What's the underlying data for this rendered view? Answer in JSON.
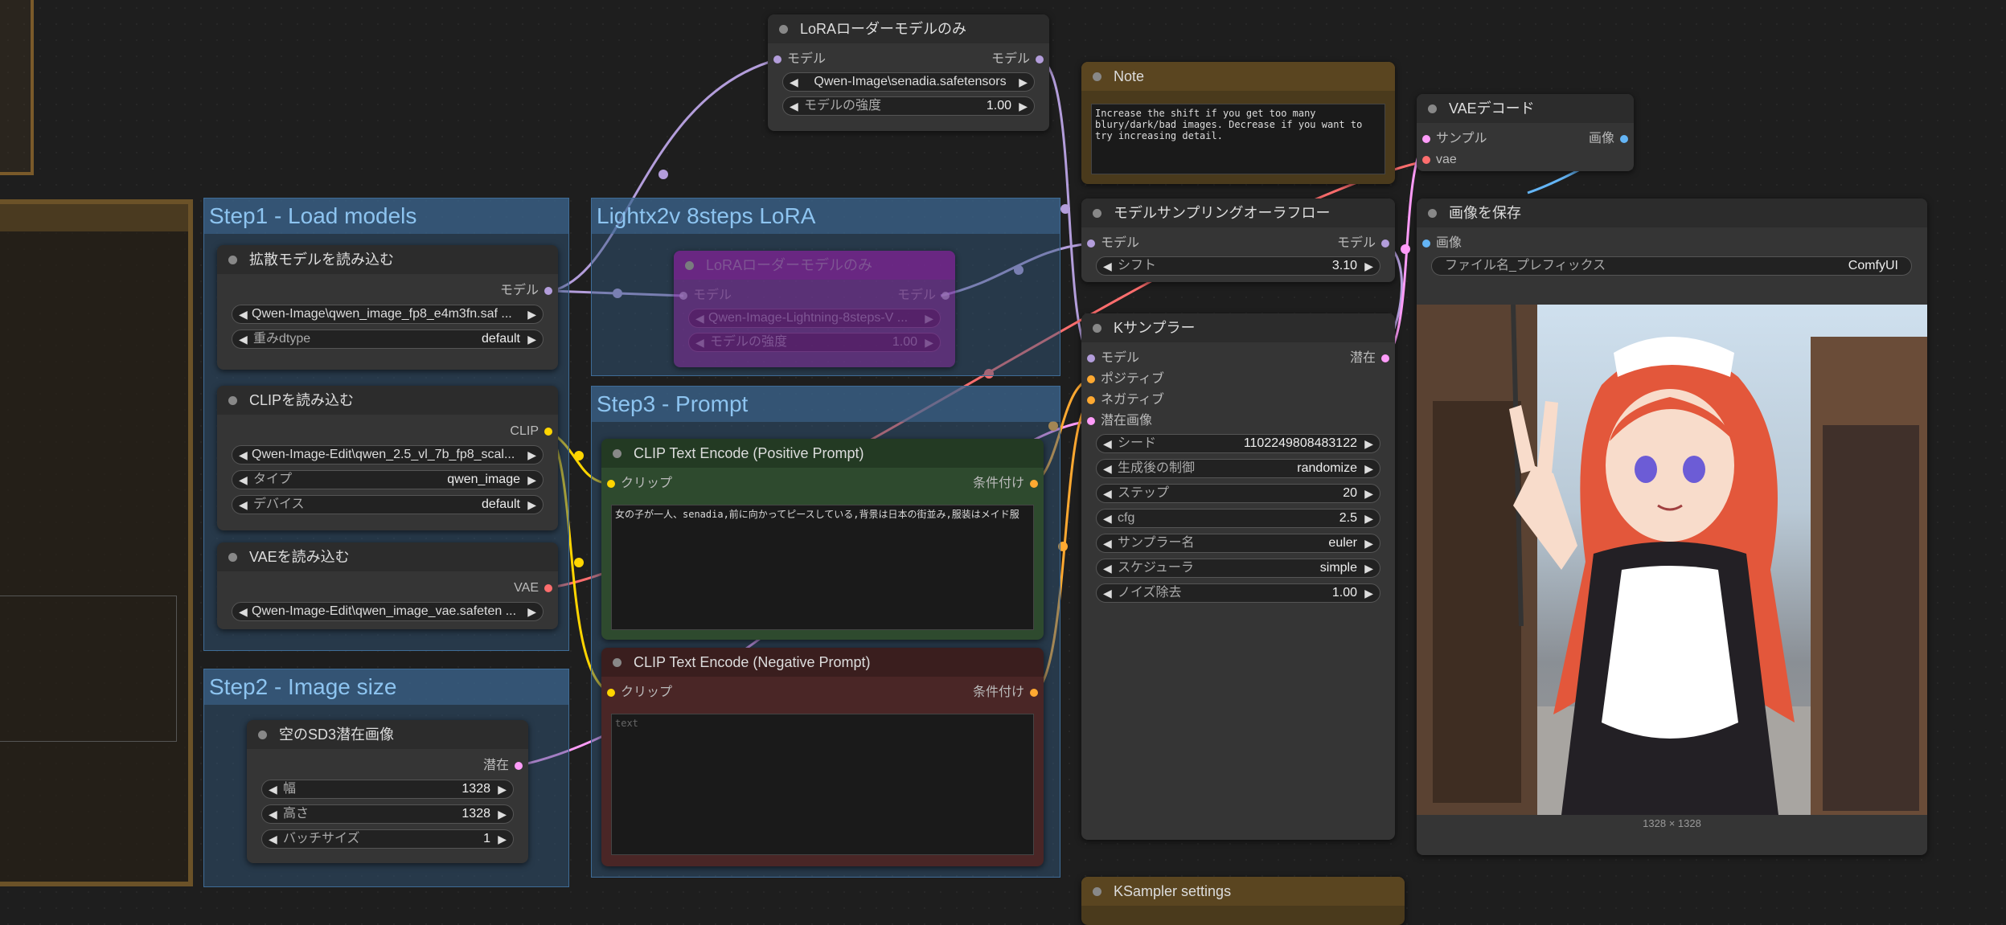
{
  "groups": {
    "step1": "Step1 - Load models",
    "step2": "Step2 - Image size",
    "step3": "Step3 - Prompt",
    "lightx2v": "Lightx2v 8steps LoRA"
  },
  "nodes": {
    "lora_top": {
      "title": "LoRAローダーモデルのみ",
      "in_model": "モデル",
      "out_model": "モデル",
      "lora_name": "Qwen-Image\\senadia.safetensors",
      "strength_label": "モデルの強度",
      "strength": "1.00"
    },
    "note": {
      "title": "Note",
      "text": "Increase the shift if you get too many blury/dark/bad images. Decrease if you want to try increasing detail."
    },
    "vae_decode": {
      "title": "VAEデコード",
      "in_samples": "サンプル",
      "in_vae": "vae",
      "out_image": "画像"
    },
    "model_sampling": {
      "title": "モデルサンプリングオーラフロー",
      "in_model": "モデル",
      "out_model": "モデル",
      "shift_label": "シフト",
      "shift": "3.10"
    },
    "ksampler": {
      "title": "Kサンプラー",
      "in_model": "モデル",
      "in_positive": "ポジティブ",
      "in_negative": "ネガティブ",
      "in_latent": "潜在画像",
      "out_latent": "潜在",
      "widgets": [
        {
          "label": "シード",
          "value": "1102249808483122"
        },
        {
          "label": "生成後の制御",
          "value": "randomize"
        },
        {
          "label": "ステップ",
          "value": "20"
        },
        {
          "label": "cfg",
          "value": "2.5"
        },
        {
          "label": "サンプラー名",
          "value": "euler"
        },
        {
          "label": "スケジューラ",
          "value": "simple"
        },
        {
          "label": "ノイズ除去",
          "value": "1.00"
        }
      ]
    },
    "save_image": {
      "title": "画像を保存",
      "in_image": "画像",
      "prefix_label": "ファイル名_プレフィックス",
      "prefix": "ComfyUI",
      "dims": "1328 × 1328"
    },
    "diffusion_loader": {
      "title": "拡散モデルを読み込む",
      "out_model": "モデル",
      "unet_name": "Qwen-Image\\qwen_image_fp8_e4m3fn.saf ...",
      "dtype_label": "重みdtype",
      "dtype": "default"
    },
    "lora_bypassed": {
      "title": "LoRAローダーモデルのみ",
      "in_model": "モデル",
      "out_model": "モデル",
      "lora_name": "Qwen-Image-Lightning-8steps-V ...",
      "strength_label": "モデルの強度",
      "strength": "1.00"
    },
    "clip_loader": {
      "title": "CLIPを読み込む",
      "out_clip": "CLIP",
      "clip_name": "Qwen-Image-Edit\\qwen_2.5_vl_7b_fp8_scal...",
      "type_label": "タイプ",
      "type": "qwen_image",
      "device_label": "デバイス",
      "device": "default"
    },
    "vae_loader": {
      "title": "VAEを読み込む",
      "out_vae": "VAE",
      "vae_name": "Qwen-Image-Edit\\qwen_image_vae.safeten ..."
    },
    "clip_pos": {
      "title": "CLIP Text Encode (Positive Prompt)",
      "in_clip": "クリップ",
      "out_cond": "条件付け",
      "text": "女の子が一人、senadia,前に向かってピースしている,背景は日本の街並み,服装はメイド服"
    },
    "clip_neg": {
      "title": "CLIP Text Encode (Negative Prompt)",
      "in_clip": "クリップ",
      "out_cond": "条件付け",
      "placeholder": "text"
    },
    "empty_latent": {
      "title": "空のSD3潜在画像",
      "out_latent": "潜在",
      "width_label": "幅",
      "width": "1328",
      "height_label": "高さ",
      "height": "1328",
      "batch_label": "バッチサイズ",
      "batch": "1"
    },
    "ksampler_settings": {
      "title": "KSampler settings"
    }
  },
  "colors": {
    "model": "#b39ddb",
    "clip": "#ffd500",
    "vae": "#ff6e6e",
    "latent": "#ff9cf9",
    "cond": "#ffa931",
    "image": "#64b5f6"
  }
}
